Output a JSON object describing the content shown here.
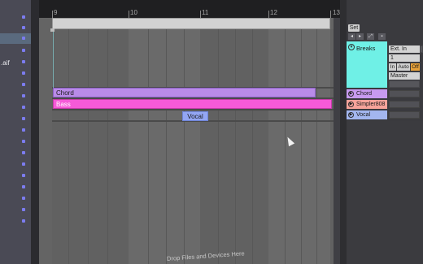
{
  "browser": {
    "file_label": ".aif"
  },
  "ruler": {
    "bars": [
      "9",
      "10",
      "11",
      "12",
      "13"
    ]
  },
  "clips": {
    "chord": "Chord",
    "bass": "Bass",
    "vocal": "Vocal"
  },
  "drop_area": {
    "text": "Drop Files and Devices Here"
  },
  "session": {
    "set_label": "Set"
  },
  "tracks": [
    {
      "name": "Breaks",
      "color": "#6ff0e6"
    },
    {
      "name": "Chord",
      "color": "#c79af0"
    },
    {
      "name": "Simpler808",
      "color": "#f7a39a"
    },
    {
      "name": "Vocal",
      "color": "#a3b6ef"
    }
  ],
  "io": {
    "input_type": "Ext. In",
    "channel": "1",
    "monitor_in": "In",
    "monitor_auto": "Auto",
    "monitor_off": "Off",
    "output": "Master"
  },
  "colors": {
    "clip_chord": "#b98be8",
    "clip_bass": "#f65ad8",
    "clip_vocal": "#93a6f4",
    "accent_orange": "#e8a23a"
  }
}
